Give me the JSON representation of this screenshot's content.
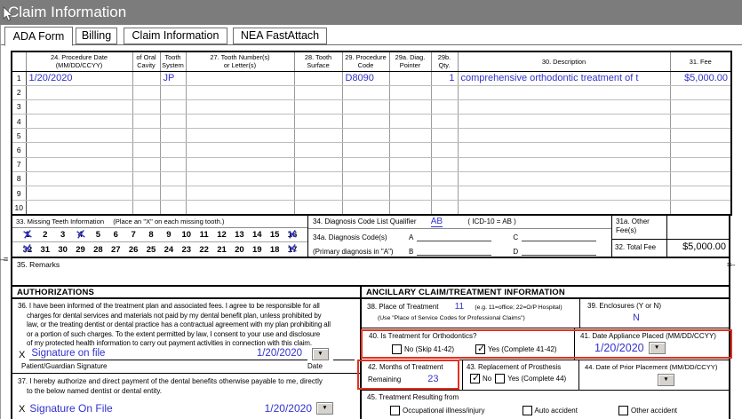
{
  "window": {
    "title": "Claim Information"
  },
  "tabs": [
    {
      "label": "ADA Form"
    },
    {
      "label": "Billing"
    },
    {
      "label": "Claim Information"
    },
    {
      "label": "NEA FastAttach"
    }
  ],
  "procedure_table": {
    "headers": [
      {
        "l1": "24. Procedure Date",
        "l2": "(MM/DD/CCYY)"
      },
      {
        "l1": "of Oral",
        "l2": "Cavity"
      },
      {
        "l1": "Tooth",
        "l2": "System"
      },
      {
        "l1": "27. Tooth Number(s)",
        "l2": "or Letter(s)"
      },
      {
        "l1": "28. Tooth",
        "l2": "Surface"
      },
      {
        "l1": "29. Procedure",
        "l2": "Code"
      },
      {
        "l1": "29a. Diag.",
        "l2": "Pointer"
      },
      {
        "l1": "29b.",
        "l2": "Qty."
      },
      {
        "l1": "30. Description",
        "l2": ""
      },
      {
        "l1": "31. Fee",
        "l2": ""
      }
    ],
    "rows": [
      {
        "num": "1",
        "date": "1/20/2020",
        "oral": "",
        "system": "JP",
        "tooth": "",
        "surface": "",
        "code": "D8090",
        "pointer": "",
        "qty": "1",
        "desc": "comprehensive orthodontic treatment of t",
        "fee": "$5,000.00"
      },
      {
        "num": "2",
        "date": "",
        "oral": "",
        "system": "",
        "tooth": "",
        "surface": "",
        "code": "",
        "pointer": "",
        "qty": "",
        "desc": "",
        "fee": ""
      },
      {
        "num": "3",
        "date": "",
        "oral": "",
        "system": "",
        "tooth": "",
        "surface": "",
        "code": "",
        "pointer": "",
        "qty": "",
        "desc": "",
        "fee": ""
      },
      {
        "num": "4",
        "date": "",
        "oral": "",
        "system": "",
        "tooth": "",
        "surface": "",
        "code": "",
        "pointer": "",
        "qty": "",
        "desc": "",
        "fee": ""
      },
      {
        "num": "5",
        "date": "",
        "oral": "",
        "system": "",
        "tooth": "",
        "surface": "",
        "code": "",
        "pointer": "",
        "qty": "",
        "desc": "",
        "fee": ""
      },
      {
        "num": "6",
        "date": "",
        "oral": "",
        "system": "",
        "tooth": "",
        "surface": "",
        "code": "",
        "pointer": "",
        "qty": "",
        "desc": "",
        "fee": ""
      },
      {
        "num": "7",
        "date": "",
        "oral": "",
        "system": "",
        "tooth": "",
        "surface": "",
        "code": "",
        "pointer": "",
        "qty": "",
        "desc": "",
        "fee": ""
      },
      {
        "num": "8",
        "date": "",
        "oral": "",
        "system": "",
        "tooth": "",
        "surface": "",
        "code": "",
        "pointer": "",
        "qty": "",
        "desc": "",
        "fee": ""
      },
      {
        "num": "9",
        "date": "",
        "oral": "",
        "system": "",
        "tooth": "",
        "surface": "",
        "code": "",
        "pointer": "",
        "qty": "",
        "desc": "",
        "fee": ""
      },
      {
        "num": "10",
        "date": "",
        "oral": "",
        "system": "",
        "tooth": "",
        "surface": "",
        "code": "",
        "pointer": "",
        "qty": "",
        "desc": "",
        "fee": ""
      }
    ]
  },
  "missing_teeth": {
    "label": "33. Missing Teeth Information",
    "hint": "(Place an \"X\" on each missing tooth.)",
    "upper": [
      {
        "n": "1",
        "x": true
      },
      {
        "n": "2"
      },
      {
        "n": "3"
      },
      {
        "n": "4",
        "x": true
      },
      {
        "n": "5"
      },
      {
        "n": "6"
      },
      {
        "n": "7"
      },
      {
        "n": "8"
      },
      {
        "n": "9"
      },
      {
        "n": "10"
      },
      {
        "n": "11"
      },
      {
        "n": "12"
      },
      {
        "n": "13"
      },
      {
        "n": "14"
      },
      {
        "n": "15"
      },
      {
        "n": "16",
        "x": true
      }
    ],
    "lower": [
      {
        "n": "32",
        "x": true
      },
      {
        "n": "31"
      },
      {
        "n": "30"
      },
      {
        "n": "29"
      },
      {
        "n": "28"
      },
      {
        "n": "27"
      },
      {
        "n": "26"
      },
      {
        "n": "25"
      },
      {
        "n": "24"
      },
      {
        "n": "23"
      },
      {
        "n": "22"
      },
      {
        "n": "21"
      },
      {
        "n": "20"
      },
      {
        "n": "19"
      },
      {
        "n": "18"
      },
      {
        "n": "17",
        "x": true
      }
    ]
  },
  "diagnosis": {
    "qualifier_label": "34. Diagnosis Code List Qualifier",
    "qualifier_value": "AB",
    "qualifier_note": "( ICD-10 = AB )",
    "codes_label": "34a. Diagnosis Code(s)",
    "primary_label": "(Primary diagnosis in \"A\")",
    "slot_a": "A",
    "slot_b": "B",
    "slot_c": "C",
    "slot_d": "D"
  },
  "fees": {
    "other_label1": "31a. Other",
    "other_label2": "Fee(s)",
    "total_label": "32. Total Fee",
    "total_value": "$5,000.00"
  },
  "remarks_label": "35. Remarks",
  "authorizations": {
    "header": "AUTHORIZATIONS",
    "p36_lines": [
      "36. I have been informed of the treatment plan and associated fees. I agree to be responsible for all",
      "charges for dental services and materials not paid by my dental benefit plan, unless prohibited by",
      "law, or the treating dentist or dental practice has a contractual agreement with my plan prohibiting all",
      "or a portion of such charges. To the extent permitted by law, I consent to your use and disclosure",
      "of my protected health information to carry out payment activities in connection with this claim."
    ],
    "sig1": {
      "x": "X",
      "text": "Signature on file",
      "date": "1/20/2020",
      "name_label": "Patient/Guardian Signature",
      "date_label": "Date"
    },
    "p37_lines": [
      "37. I hereby authorize and direct payment of the dental benefits otherwise payable to me, directly",
      "to the below named dentist or dental entity."
    ],
    "sig2": {
      "x": "X",
      "text": "Signature On File",
      "date": "1/20/2020"
    }
  },
  "ancillary": {
    "header": "ANCILLARY CLAIM/TREATMENT INFORMATION",
    "place": {
      "label": "38. Place of Treatment",
      "value": "11",
      "hint": "(e.g. 11=office; 22=O/P Hospital)",
      "hint2": "(Use \"Place of Service Codes for Professional Claims\")"
    },
    "enclosures": {
      "label": "39. Enclosures (Y or N)",
      "value": "N"
    },
    "ortho": {
      "label": "40. Is Treatment for Orthodontics?",
      "no_label": "No  (Skip 41-42)",
      "yes_label": "Yes (Complete 41-42)",
      "no_checked": false,
      "yes_checked": true
    },
    "appliance": {
      "label": "41. Date Appliance Placed (MM/DD/CCYY)",
      "value": "1/20/2020"
    },
    "months": {
      "label1": "42. Months of Treatment",
      "label2": "Remaining",
      "value": "23"
    },
    "prosthesis": {
      "label": "43. Replacement of Prosthesis",
      "no_label": "No",
      "yes_label": "Yes (Complete 44)",
      "no_checked": true,
      "yes_checked": false
    },
    "prior": {
      "label": "44. Date of Prior Placement (MM/DD/CCYY)",
      "value": ""
    },
    "resulting": {
      "label": "45. Treatment Resulting from",
      "options": [
        {
          "label": "Occupational illness/injury"
        },
        {
          "label": "Auto accident"
        },
        {
          "label": "Other accident"
        }
      ]
    }
  },
  "colors": {
    "accent_blue": "#3232cd",
    "highlight_red": "#e5311f",
    "titlebar_gray": "#7c7c7c"
  }
}
